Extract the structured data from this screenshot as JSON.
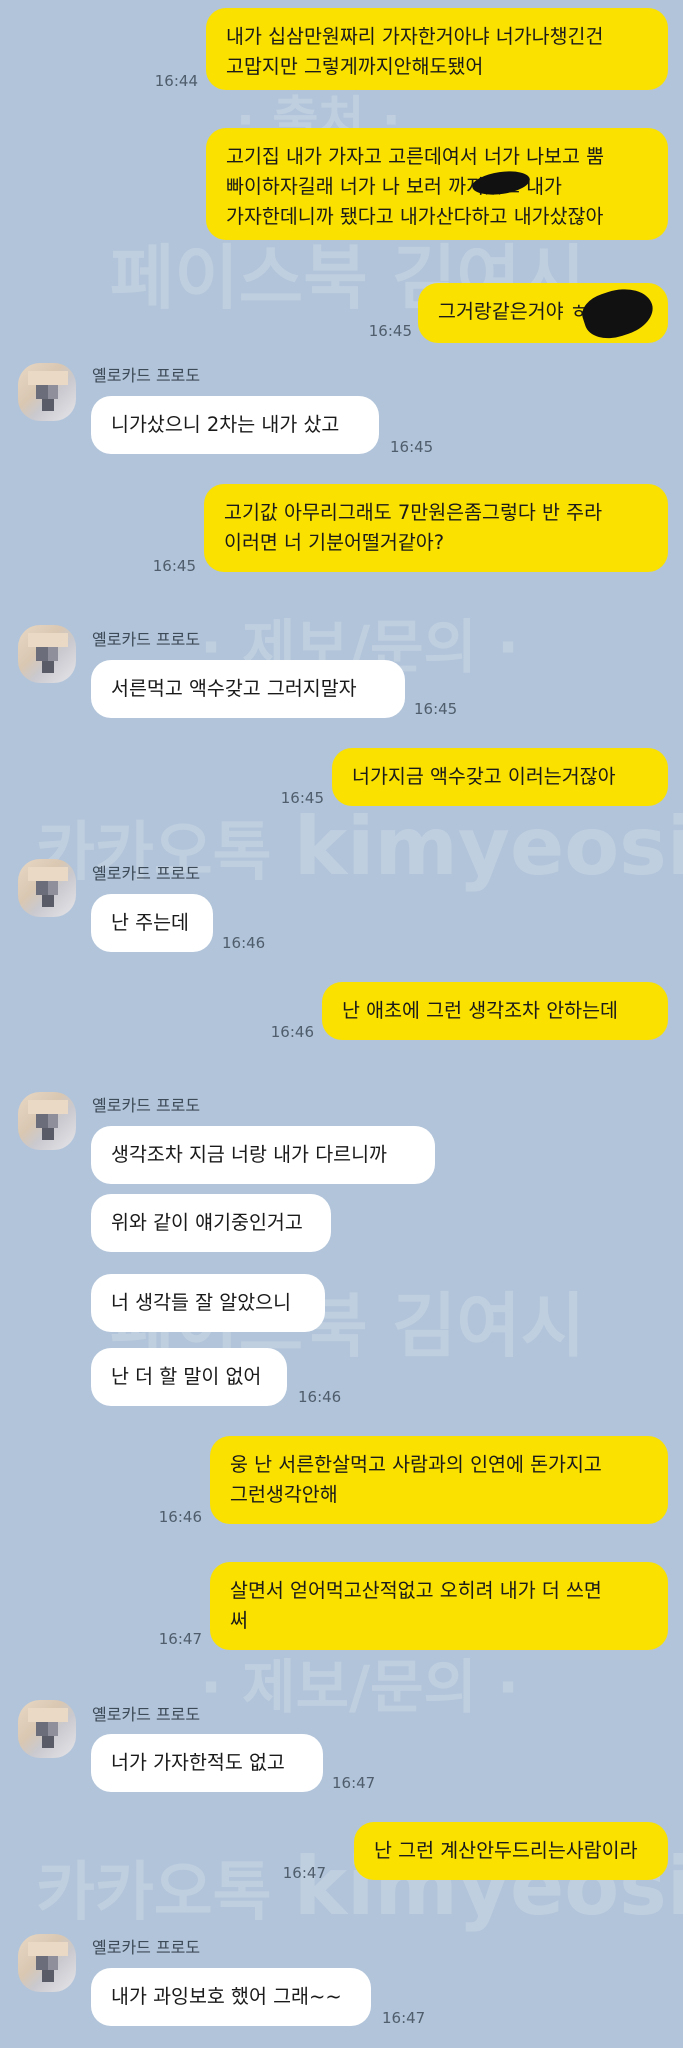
{
  "sender_name": "옐로카드 프로도",
  "watermark": {
    "source": "· 출처 ·",
    "facebook": "페이스북 김여시",
    "report": "· 제보/문의 ·",
    "kakao": "카카오톡",
    "kakao_id": "kimyeosi"
  },
  "messages": [
    {
      "lines": [
        "내가 십삼만원짜리 가자한거아냐 너가나챙긴건",
        "고맙지만 그렇게까지안해도됐어"
      ],
      "time": "16:44"
    },
    {
      "lines": [
        "고기집 내가 가자고 고른데여서 너가 나보고 뿜",
        "빠이하자길래 너가 나 보러      까지왔고 내가",
        "가자한데니까 됐다고 내가산다하고 내가샀잖아"
      ],
      "time": ""
    },
    {
      "lines": [
        "그거랑같은거야 ㅎ"
      ],
      "time": "16:45"
    },
    {
      "lines": [
        "니가샀으니 2차는 내가 샀고"
      ],
      "time": "16:45"
    },
    {
      "lines": [
        "고기값 아무리그래도 7만원은좀그렇다 반 주라",
        "이러면 너 기분어떨거같아?"
      ],
      "time": "16:45"
    },
    {
      "lines": [
        "서른먹고 액수갖고 그러지말자"
      ],
      "time": "16:45"
    },
    {
      "lines": [
        "너가지금 액수갖고 이러는거잖아"
      ],
      "time": "16:45"
    },
    {
      "lines": [
        "난 주는데"
      ],
      "time": "16:46"
    },
    {
      "lines": [
        "난 애초에 그런 생각조차 안하는데"
      ],
      "time": "16:46"
    },
    {
      "lines": [
        "생각조차 지금 너랑 내가 다르니까"
      ],
      "time": ""
    },
    {
      "lines": [
        "위와 같이 얘기중인거고"
      ],
      "time": ""
    },
    {
      "lines": [
        "너 생각들 잘 알았으니"
      ],
      "time": ""
    },
    {
      "lines": [
        "난 더 할 말이 없어"
      ],
      "time": "16:46"
    },
    {
      "lines": [
        "웅 난 서른한살먹고 사람과의 인연에 돈가지고",
        "그런생각안해"
      ],
      "time": "16:46"
    },
    {
      "lines": [
        "살면서 얻어먹고산적없고 오히려 내가 더 쓰면",
        "써"
      ],
      "time": "16:47"
    },
    {
      "lines": [
        "너가 가자한적도 없고"
      ],
      "time": "16:47"
    },
    {
      "lines": [
        "난 그런 계산안두드리는사람이라"
      ],
      "time": "16:47"
    },
    {
      "lines": [
        "내가 과잉보호 했어 그래~~"
      ],
      "time": "16:47"
    }
  ]
}
